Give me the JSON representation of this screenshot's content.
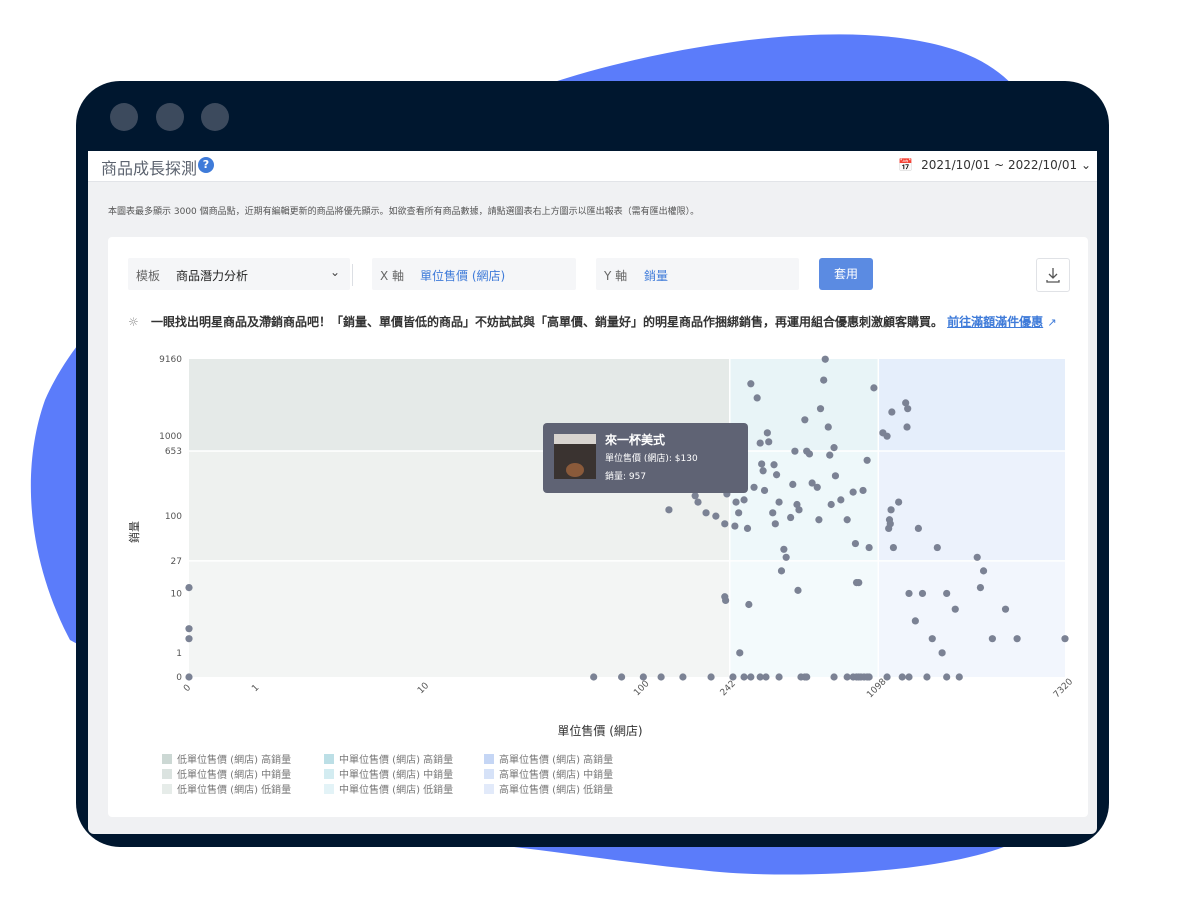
{
  "page": {
    "title": "商品成長探測",
    "help_icon": "?",
    "date_range": "2021/10/01 ~ 2022/10/01",
    "note": "本圖表最多顯示 3000 個商品點，近期有編輯更新的商品將優先顯示。如欲查看所有商品數據，請點選圖表右上方圖示以匯出報表（需有匯出權限）。",
    "colors": {
      "brand_blue": "#5b7cfa",
      "frame": "#00172f",
      "accent": "#3f7bd9",
      "button": "#5b8be2",
      "point": "#7b8294"
    }
  },
  "controls": {
    "template_label": "模板",
    "template_value": "商品潛力分析",
    "x_label": "X 軸",
    "x_value": "單位售價 (網店)",
    "y_label": "Y 軸",
    "y_value": "銷量",
    "apply": "套用",
    "download_icon": "download-icon"
  },
  "tip": {
    "text": "一眼找出明星商品及滯銷商品吧！「銷量、單價皆低的商品」不妨試試與「高單價、銷量好」的明星商品作捆綁銷售，再運用組合優惠刺激顧客購買。",
    "link": "前往滿額滿件優惠"
  },
  "tooltip": {
    "title": "來一杯美式",
    "line1": "單位售價 (網店): $130",
    "line2": "銷量: 957"
  },
  "legend": [
    [
      "低單位售價 (網店) 高銷量",
      "中單位售價 (網店) 高銷量",
      "高單位售價 (網店) 高銷量"
    ],
    [
      "低單位售價 (網店) 中銷量",
      "中單位售價 (網店) 中銷量",
      "高單位售價 (網店) 中銷量"
    ],
    [
      "低單位售價 (網店) 低銷量",
      "中單位售價 (網店) 低銷量",
      "高單位售價 (網店) 低銷量"
    ]
  ],
  "chart_data": {
    "type": "scatter",
    "xlabel": "單位售價 (網店)",
    "ylabel": "銷量",
    "x_scale": "log",
    "y_scale": "log",
    "xlim": [
      0,
      7320
    ],
    "ylim": [
      0,
      9160
    ],
    "x_ticks": [
      "0",
      "1",
      "10",
      "100",
      "242",
      "1098",
      "7320"
    ],
    "y_ticks": [
      "0",
      "1",
      "10",
      "27",
      "100",
      "653",
      "1000",
      "9160"
    ],
    "x_thresholds": [
      242,
      1098
    ],
    "y_thresholds": [
      27,
      653
    ],
    "zone_colors": {
      "low_high": "#e5eae8",
      "low_mid": "#eef1ef",
      "low_low": "#f3f5f4",
      "mid_high": "#e8f4f7",
      "mid_mid": "#eef8fa",
      "mid_low": "#f3fafc",
      "high_high": "#e5eefb",
      "high_mid": "#ecf2fc",
      "high_low": "#f2f6fd"
    },
    "legend_colors": [
      [
        "#ccd8d4",
        "#bcdfe6",
        "#c5d6f5"
      ],
      [
        "#dbe3e0",
        "#d3ecf1",
        "#d6e2f8"
      ],
      [
        "#e6ece9",
        "#e3f3f7",
        "#e2eafa"
      ]
    ],
    "highlight": {
      "x": 130,
      "y": 957
    },
    "points": [
      [
        0,
        12
      ],
      [
        0,
        3
      ],
      [
        0,
        2
      ],
      [
        0,
        0
      ],
      [
        60,
        0
      ],
      [
        80,
        0
      ],
      [
        100,
        0
      ],
      [
        120,
        0
      ],
      [
        150,
        0
      ],
      [
        200,
        0
      ],
      [
        250,
        0
      ],
      [
        280,
        0
      ],
      [
        300,
        0
      ],
      [
        330,
        0
      ],
      [
        350,
        0
      ],
      [
        400,
        0
      ],
      [
        500,
        0
      ],
      [
        520,
        0
      ],
      [
        530,
        0
      ],
      [
        700,
        0
      ],
      [
        800,
        0
      ],
      [
        850,
        0
      ],
      [
        880,
        0
      ],
      [
        900,
        0
      ],
      [
        920,
        0
      ],
      [
        950,
        0
      ],
      [
        980,
        0
      ],
      [
        1000,
        0
      ],
      [
        1200,
        0
      ],
      [
        1400,
        0
      ],
      [
        1500,
        0
      ],
      [
        1800,
        0
      ],
      [
        2200,
        0
      ],
      [
        2500,
        0
      ],
      [
        130,
        957
      ],
      [
        130,
        120
      ],
      [
        125,
        350
      ],
      [
        140,
        700
      ],
      [
        140,
        450
      ],
      [
        165,
        560
      ],
      [
        160,
        270
      ],
      [
        170,
        180
      ],
      [
        175,
        150
      ],
      [
        190,
        110
      ],
      [
        210,
        100
      ],
      [
        195,
        220
      ],
      [
        230,
        80
      ],
      [
        235,
        190
      ],
      [
        255,
        75
      ],
      [
        258,
        150
      ],
      [
        265,
        110
      ],
      [
        270,
        570
      ],
      [
        272,
        320
      ],
      [
        276,
        610
      ],
      [
        230,
        9
      ],
      [
        232,
        8
      ],
      [
        268,
        1
      ],
      [
        280,
        160
      ],
      [
        290,
        70
      ],
      [
        294,
        7
      ],
      [
        300,
        4500
      ],
      [
        310,
        230
      ],
      [
        320,
        3000
      ],
      [
        330,
        820
      ],
      [
        335,
        450
      ],
      [
        340,
        370
      ],
      [
        345,
        210
      ],
      [
        355,
        1100
      ],
      [
        360,
        850
      ],
      [
        375,
        110
      ],
      [
        380,
        440
      ],
      [
        385,
        80
      ],
      [
        390,
        330
      ],
      [
        400,
        150
      ],
      [
        410,
        20
      ],
      [
        420,
        38
      ],
      [
        430,
        30
      ],
      [
        450,
        96
      ],
      [
        460,
        250
      ],
      [
        470,
        650
      ],
      [
        480,
        140
      ],
      [
        490,
        120
      ],
      [
        485,
        11
      ],
      [
        520,
        1600
      ],
      [
        530,
        650
      ],
      [
        545,
        600
      ],
      [
        560,
        260
      ],
      [
        590,
        230
      ],
      [
        600,
        90
      ],
      [
        610,
        2200
      ],
      [
        630,
        5000
      ],
      [
        640,
        9100
      ],
      [
        660,
        1300
      ],
      [
        670,
        580
      ],
      [
        680,
        140
      ],
      [
        700,
        720
      ],
      [
        710,
        320
      ],
      [
        750,
        160
      ],
      [
        800,
        90
      ],
      [
        850,
        200
      ],
      [
        870,
        45
      ],
      [
        880,
        14
      ],
      [
        900,
        14
      ],
      [
        940,
        210
      ],
      [
        980,
        500
      ],
      [
        1000,
        40
      ],
      [
        1050,
        4000
      ],
      [
        1150,
        1100
      ],
      [
        1200,
        1000
      ],
      [
        1220,
        70
      ],
      [
        1230,
        90
      ],
      [
        1250,
        120
      ],
      [
        1260,
        2000
      ],
      [
        1240,
        80
      ],
      [
        1280,
        40
      ],
      [
        1350,
        150
      ],
      [
        1450,
        2600
      ],
      [
        1470,
        1300
      ],
      [
        1480,
        2200
      ],
      [
        1500,
        10
      ],
      [
        1600,
        4
      ],
      [
        1650,
        70
      ],
      [
        1720,
        10
      ],
      [
        1900,
        2
      ],
      [
        2000,
        40
      ],
      [
        2100,
        1
      ],
      [
        2200,
        10
      ],
      [
        2400,
        6
      ],
      [
        3000,
        30
      ],
      [
        3100,
        12
      ],
      [
        3200,
        20
      ],
      [
        3500,
        2
      ],
      [
        4000,
        6
      ],
      [
        4500,
        2
      ],
      [
        7320,
        2
      ]
    ]
  }
}
